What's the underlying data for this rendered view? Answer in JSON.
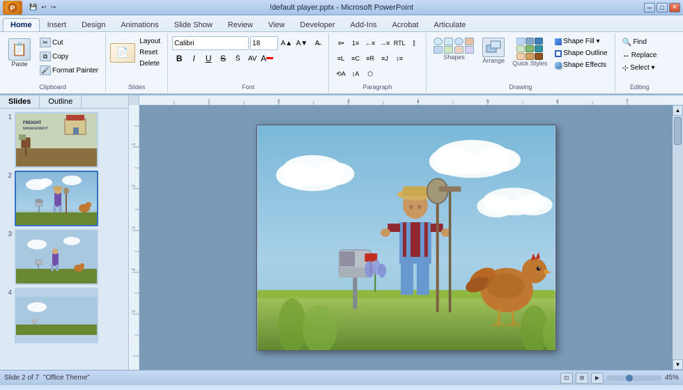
{
  "titlebar": {
    "title": "!default player.pptx - Microsoft PowerPoint",
    "minimize": "─",
    "maximize": "□",
    "close": "✕"
  },
  "ribbon": {
    "tabs": [
      "Home",
      "Insert",
      "Design",
      "Animations",
      "Slide Show",
      "Review",
      "View",
      "Developer",
      "Add-Ins",
      "Acrobat",
      "Articulate"
    ],
    "active_tab": "Home",
    "groups": {
      "clipboard": {
        "label": "Clipboard",
        "paste": "Paste",
        "cut": "Cut",
        "copy": "Copy",
        "format_painter": "Format Painter"
      },
      "slides": {
        "label": "Slides",
        "new_slide": "New Slide",
        "layout": "Layout",
        "reset": "Reset",
        "delete": "Delete"
      },
      "font": {
        "label": "Font",
        "font_name": "Calibri",
        "font_size": "18"
      },
      "paragraph": {
        "label": "Paragraph"
      },
      "drawing": {
        "label": "Drawing"
      },
      "quick_styles": {
        "label": "Quick Styles"
      },
      "shape_fill": {
        "label": "Shape Fill ▾"
      },
      "shape_outline": {
        "label": "Shape Outline"
      },
      "shape_effects": {
        "label": "Shape Effects"
      },
      "editing": {
        "label": "Editing",
        "find": "Find",
        "replace": "Replace",
        "select": "Select ▾"
      }
    }
  },
  "slides": {
    "tabs": [
      "Slides",
      "Outline"
    ],
    "active_tab": "Slides",
    "items": [
      {
        "num": "1"
      },
      {
        "num": "2"
      },
      {
        "num": "3"
      },
      {
        "num": "4"
      }
    ]
  },
  "statusbar": {
    "slide_info": "Slide 2 of 7",
    "theme": "\"Office Theme\"",
    "zoom": "45%"
  }
}
